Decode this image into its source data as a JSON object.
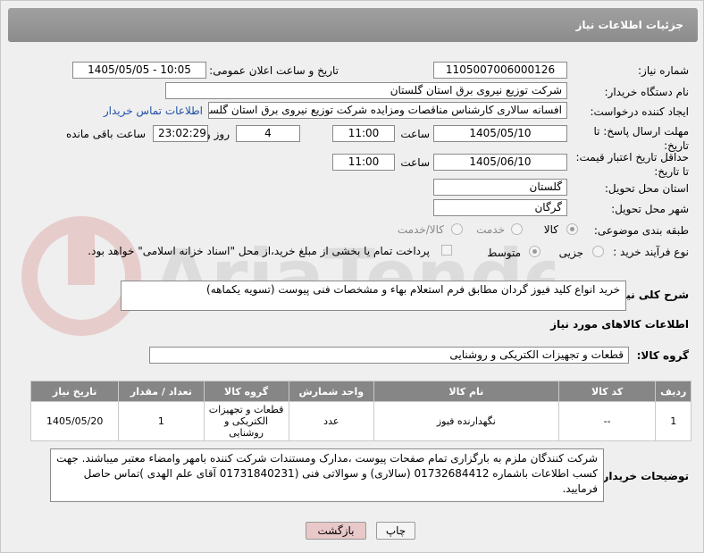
{
  "header": {
    "title": "جزئیات اطلاعات نیاز"
  },
  "fields": {
    "need_number_label": "شماره نیاز:",
    "need_number": "1105007006000126",
    "announce_label": "تاریخ و ساعت اعلان عمومی:",
    "announce_value": "1405/05/05 - 10:05",
    "buyer_org_label": "نام دستگاه خریدار:",
    "buyer_org": "شرکت توزیع نیروی برق استان گلستان",
    "requester_label": "ایجاد کننده درخواست:",
    "requester": "افسانه سالاری کارشناس مناقصات ومزایده شرکت توزیع نیروی برق استان گلستان",
    "contact_link": "اطلاعات تماس خریدار",
    "deadline_label": "مهلت ارسال پاسخ: تا تاریخ:",
    "deadline_date": "1405/05/10",
    "time_word": "ساعت",
    "deadline_time": "11:00",
    "days_value": "4",
    "days_word": "روز و",
    "remaining_time": "23:02:29",
    "remaining_word": "ساعت باقی مانده",
    "price_validity_label": "حداقل تاریخ اعتبار قیمت: تا تاریخ:",
    "price_date": "1405/06/10",
    "price_time": "11:00",
    "province_label": "استان محل تحویل:",
    "province": "گلستان",
    "city_label": "شهر محل تحویل:",
    "city": "گرگان",
    "category_label": "طبقه بندی موضوعی:",
    "cat_goods": "کالا",
    "cat_service": "خدمت",
    "cat_both": "کالا/خدمت",
    "process_label": "نوع فرآیند خرید :",
    "proc_small": "جزیی",
    "proc_medium": "متوسط",
    "payment_note": "پرداخت تمام یا بخشی از مبلغ خرید،از محل \"اسناد خزانه اسلامی\" خواهد بود."
  },
  "summary": {
    "label": "شرح کلی نیاز:",
    "text": "خرید انواع کلید فیوز گردان مطابق فرم استعلام بهاء و مشخصات فنی پیوست (تسویه یکماهه)"
  },
  "goods_section": {
    "title": "اطلاعات کالاهای مورد نیاز",
    "group_label": "گروه کالا:",
    "group_value": "قطعات و تجهیزات الکتریکی و روشنایی"
  },
  "table": {
    "headers": [
      "ردیف",
      "کد کالا",
      "نام کالا",
      "واحد شمارش",
      "گروه کالا",
      "تعداد / مقدار",
      "تاریخ نیاز"
    ],
    "rows": [
      [
        "1",
        "--",
        "نگهدارنده فیوز",
        "عدد",
        "قطعات و تجهیزات الکتریکی و روشنایی",
        "1",
        "1405/05/20"
      ]
    ]
  },
  "buyer_notes": {
    "label": "توضیحات خریدار:",
    "text": "شرکت کنندگان ملزم به بارگزاری تمام صفحات پیوست ،مدارک ومستندات شرکت کننده بامهر وامضاء معتبر میباشند. جهت کسب اطلاعات باشماره 01732684412 (سالاری) و سوالاتی فنی (01731840231 آقای علم الهدی )تماس حاصل فرمایید."
  },
  "buttons": {
    "print": "چاپ",
    "back": "بازگشت"
  },
  "watermark": {
    "text": "AriaTender.net"
  },
  "colors": {
    "header_bg": "#8c8c8c",
    "panel_bg": "#efefef",
    "link": "#1f4fa8",
    "back_button": "#e8c8c8"
  }
}
